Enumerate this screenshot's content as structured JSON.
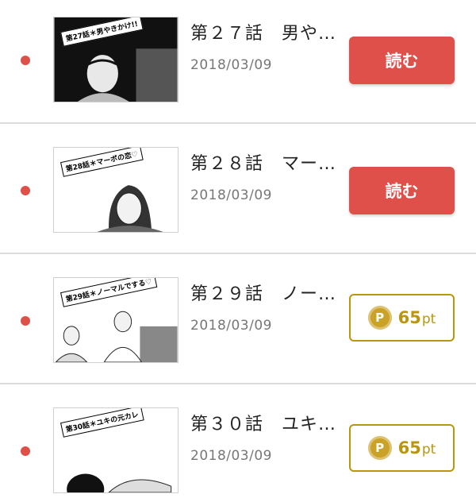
{
  "colors": {
    "unread_dot": "#e0504a",
    "read_button": "#e0504a",
    "gold": "#b8960e",
    "coin": "#c9a227"
  },
  "episodes": [
    {
      "title": "第２７話　男や…",
      "date": "2018/03/09",
      "thumb_tag": "第27話＊男やきかけ!!",
      "action": "read",
      "read_label": "読む"
    },
    {
      "title": "第２８話　マー…",
      "date": "2018/03/09",
      "thumb_tag": "第28話＊マーボの恋♡",
      "action": "read",
      "read_label": "読む"
    },
    {
      "title": "第２９話　ノー…",
      "date": "2018/03/09",
      "thumb_tag": "第29話＊ノーマルでする♡",
      "action": "points",
      "coin_icon": "P",
      "points": "65",
      "points_unit": "pt"
    },
    {
      "title": "第３０話　ユキ…",
      "date": "2018/03/09",
      "thumb_tag": "第30話＊ユキの元カレ",
      "action": "points",
      "coin_icon": "P",
      "points": "65",
      "points_unit": "pt"
    }
  ]
}
